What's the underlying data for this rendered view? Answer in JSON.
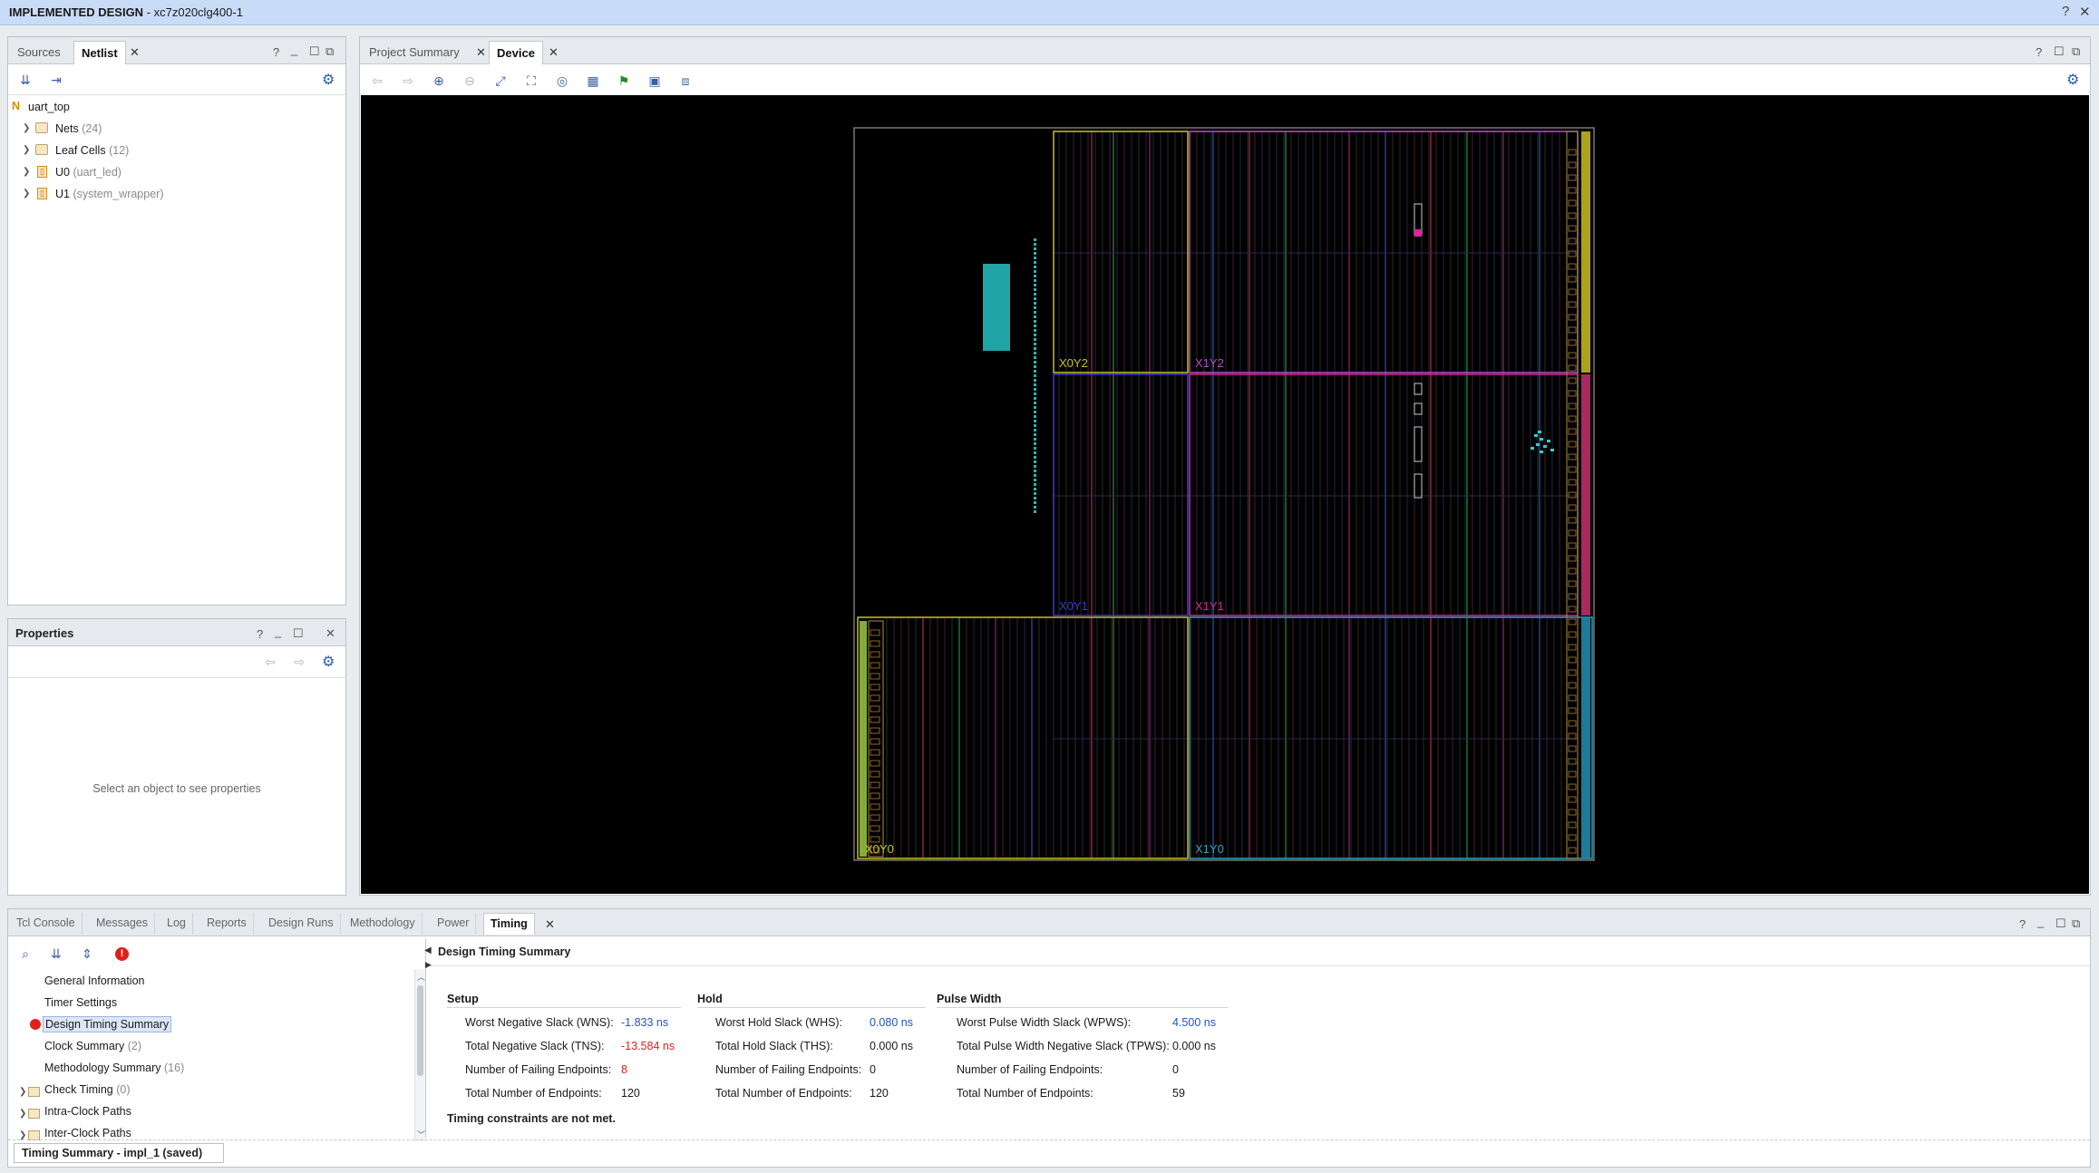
{
  "window": {
    "title_bold": "IMPLEMENTED DESIGN",
    "title_rest": " - xc7z020clg400-1",
    "help": "?",
    "close": "✕"
  },
  "left_top": {
    "tabs": [
      {
        "label": "Sources"
      },
      {
        "label": "Netlist"
      }
    ],
    "close": "✕",
    "ctl": {
      "help": "?",
      "min": "_",
      "max": "☐",
      "float": "⧉"
    },
    "root": "uart_top",
    "root_icon": "N",
    "items": [
      {
        "label": "Nets",
        "count": "(24)"
      },
      {
        "label": "Leaf Cells",
        "count": "(12)"
      },
      {
        "label": "U0",
        "count": "(uart_led)"
      },
      {
        "label": "U1",
        "count": "(system_wrapper)"
      }
    ]
  },
  "properties": {
    "title": "Properties",
    "ctl": {
      "help": "?",
      "min": "_",
      "max": "☐",
      "close": "✕"
    },
    "empty_text": "Select an object to see properties"
  },
  "main": {
    "tabs": [
      {
        "label": "Project Summary"
      },
      {
        "label": "Device"
      }
    ],
    "close": "✕",
    "ctl": {
      "help": "?",
      "max": "☐",
      "float": "⧉"
    }
  },
  "device": {
    "regions": [
      {
        "label": "X0Y2",
        "color": "#c8c020"
      },
      {
        "label": "X1Y2",
        "color": "#b050c8"
      },
      {
        "label": "X0Y1",
        "color": "#3a3ad8"
      },
      {
        "label": "X1Y1",
        "color": "#d02890"
      },
      {
        "label": "X0Y0",
        "color": "#c8c020"
      },
      {
        "label": "X1Y0",
        "color": "#30a0c0"
      }
    ]
  },
  "bottom": {
    "tabs": [
      {
        "label": "Tcl Console"
      },
      {
        "label": "Messages"
      },
      {
        "label": "Log"
      },
      {
        "label": "Reports"
      },
      {
        "label": "Design Runs"
      },
      {
        "label": "Methodology"
      },
      {
        "label": "Power"
      },
      {
        "label": "Timing"
      }
    ],
    "close": "✕",
    "ctl": {
      "help": "?",
      "min": "_",
      "max": "☐",
      "float": "⧉"
    },
    "nav": [
      {
        "label": "General Information",
        "count": ""
      },
      {
        "label": "Timer Settings",
        "count": ""
      },
      {
        "label": "Design Timing Summary",
        "count": ""
      },
      {
        "label": "Clock Summary",
        "count": "(2)"
      },
      {
        "label": "Methodology Summary",
        "count": "(16)"
      },
      {
        "label": "Check Timing",
        "count": "(0)"
      },
      {
        "label": "Intra-Clock Paths",
        "count": ""
      },
      {
        "label": "Inter-Clock Paths",
        "count": ""
      }
    ],
    "status_tab": "Timing Summary - impl_1 (saved)"
  },
  "summary": {
    "title": "Design Timing Summary",
    "setup": {
      "heading": "Setup",
      "rows": [
        {
          "label": "Worst Negative Slack (WNS):",
          "value": "-1.833 ns"
        },
        {
          "label": "Total Negative Slack (TNS):",
          "value": "-13.584 ns"
        },
        {
          "label": "Number of Failing Endpoints:",
          "value": "8"
        },
        {
          "label": "Total Number of Endpoints:",
          "value": "120"
        }
      ]
    },
    "hold": {
      "heading": "Hold",
      "rows": [
        {
          "label": "Worst Hold Slack (WHS):",
          "value": "0.080 ns"
        },
        {
          "label": "Total Hold Slack (THS):",
          "value": "0.000 ns"
        },
        {
          "label": "Number of Failing Endpoints:",
          "value": "0"
        },
        {
          "label": "Total Number of Endpoints:",
          "value": "120"
        }
      ]
    },
    "pw": {
      "heading": "Pulse Width",
      "rows": [
        {
          "label": "Worst Pulse Width Slack (WPWS):",
          "value": "4.500 ns"
        },
        {
          "label": "Total Pulse Width Negative Slack (TPWS):",
          "value": "0.000 ns"
        },
        {
          "label": "Number of Failing Endpoints:",
          "value": "0"
        },
        {
          "label": "Total Number of Endpoints:",
          "value": "59"
        }
      ]
    },
    "note": "Timing constraints are not met."
  }
}
